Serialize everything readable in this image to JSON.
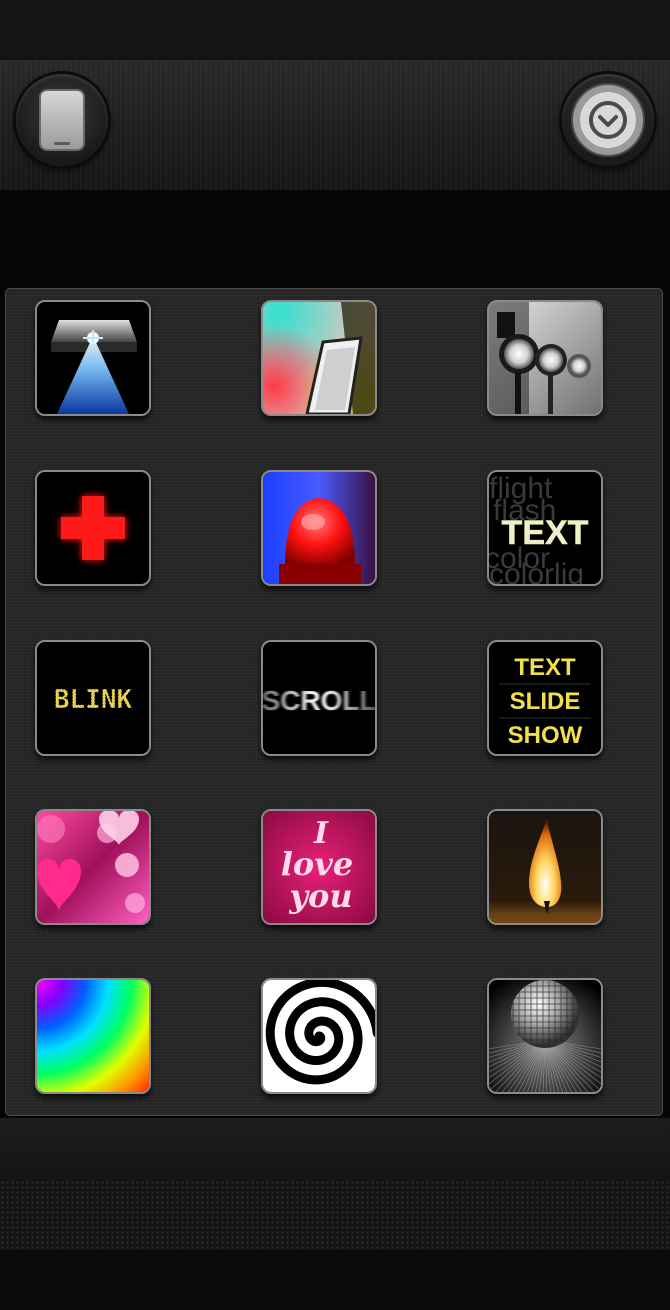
{
  "header": {
    "left_button_icon": "phone-screen-icon",
    "right_button_icon": "chevron-down-circle-icon"
  },
  "grid": {
    "tiles": [
      {
        "name": "flashlight-tile",
        "icon": "phone-flashlight-icon"
      },
      {
        "name": "color-screen-tile",
        "icon": "phone-color-light-icon"
      },
      {
        "name": "spotlights-tile",
        "icon": "stage-spotlights-icon"
      },
      {
        "name": "emergency-cross-tile",
        "icon": "red-cross-icon"
      },
      {
        "name": "police-siren-tile",
        "icon": "siren-light-icon"
      },
      {
        "name": "text-tile",
        "icon": "text-icon",
        "label": "TEXT",
        "bg_words": [
          "flight",
          "flash",
          "color",
          "colorlig"
        ]
      },
      {
        "name": "blink-tile",
        "icon": "blink-text-icon",
        "label": "BLINK"
      },
      {
        "name": "scroll-tile",
        "icon": "scroll-text-icon",
        "label": "SCROLL"
      },
      {
        "name": "text-slideshow-tile",
        "icon": "slideshow-text-icon",
        "lines": [
          "TEXT",
          "SLIDE",
          "SHOW"
        ]
      },
      {
        "name": "hearts-tile",
        "icon": "hearts-bokeh-icon"
      },
      {
        "name": "i-love-you-tile",
        "icon": "love-message-icon",
        "lines": [
          "I",
          "love",
          "you"
        ]
      },
      {
        "name": "candle-tile",
        "icon": "candle-flame-icon"
      },
      {
        "name": "rainbow-tile",
        "icon": "rainbow-gradient-icon"
      },
      {
        "name": "hypno-spiral-tile",
        "icon": "spiral-icon"
      },
      {
        "name": "disco-ball-tile",
        "icon": "disco-ball-icon"
      }
    ]
  },
  "colors": {
    "led_yellow": "#e8d44a",
    "slideshow_yellow": "#f2e04a",
    "red": "#ff1a1a",
    "pink": "#d4106a"
  }
}
